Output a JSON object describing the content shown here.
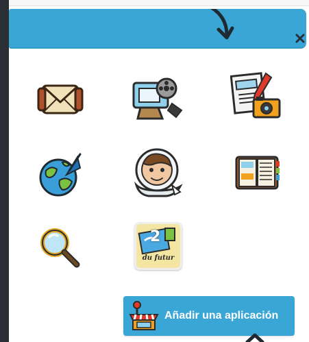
{
  "header": {
    "close_label": "×"
  },
  "apps": [
    {
      "icon": "envelope-icon"
    },
    {
      "icon": "film-projector-icon"
    },
    {
      "icon": "newspaper-camera-icon"
    },
    {
      "icon": "globe-arrow-icon"
    },
    {
      "icon": "astronaut-avatar-icon"
    },
    {
      "icon": "open-book-icon"
    },
    {
      "icon": "magnifier-icon"
    },
    {
      "icon": "du-futur-icon",
      "label": "du futur",
      "number": "2"
    }
  ],
  "add_app": {
    "label": "Añadir una aplicación",
    "icon": "shop-stall-icon"
  },
  "colors": {
    "accent": "#39a6d6",
    "rail": "#2a2f36"
  }
}
